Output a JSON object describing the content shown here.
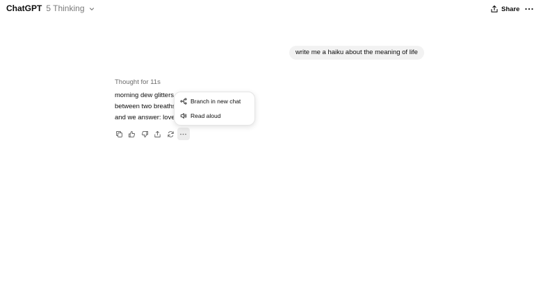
{
  "header": {
    "model_name": "ChatGPT",
    "model_variant": "5 Thinking",
    "share_label": "Share"
  },
  "conversation": {
    "user_message": "write me a haiku about the meaning of life",
    "thought_label": "Thought for 11s",
    "response_lines": [
      "morning dew glitters",
      "between two breaths",
      "and we answer: love"
    ]
  },
  "action_bar": {
    "icons": [
      "copy-icon",
      "thumbs-up-icon",
      "thumbs-down-icon",
      "share-icon",
      "regenerate-icon",
      "more-icon"
    ]
  },
  "more_menu": {
    "items": [
      {
        "label": "Branch in new chat",
        "icon": "branch-icon"
      },
      {
        "label": "Read aloud",
        "icon": "speaker-icon"
      }
    ]
  }
}
